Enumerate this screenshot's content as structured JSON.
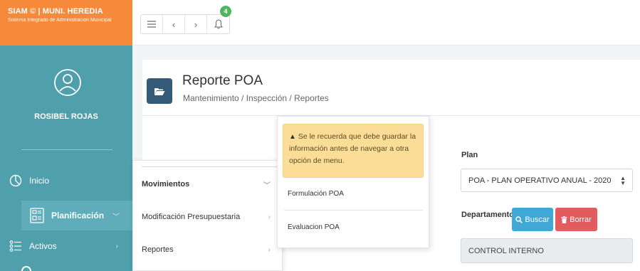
{
  "brand": {
    "title": "SIAM © | MUNI. HEREDIA",
    "subtitle": "Sistema Integrado de Administración Municipal"
  },
  "user": {
    "name": "ROSIBEL ROJAS"
  },
  "sidebar": {
    "items": [
      {
        "label": "Inicio",
        "icon": "pie-chart-icon"
      },
      {
        "label": "Planificación",
        "icon": "planning-icon"
      },
      {
        "label": "Activos",
        "icon": "list-icon"
      }
    ]
  },
  "topbar": {
    "notification_count": "4"
  },
  "page": {
    "title": "Reporte POA",
    "breadcrumb": "Mantenimiento / Inspección / Reportes"
  },
  "menu": {
    "items": [
      {
        "label": "Movimientos"
      },
      {
        "label": "Modificación Presupuestaria"
      },
      {
        "label": "Reportes"
      }
    ],
    "submenu": {
      "alert": "Se le recuerda que debe guardar la información antes de navegar a otra opción de menu.",
      "items": [
        {
          "label": "Formulación POA"
        },
        {
          "label": "Evaluacion POA"
        }
      ]
    }
  },
  "form": {
    "plan_label": "Plan",
    "plan_value": "POA - PLAN OPERATIVO ANUAL - 2020",
    "dept_label": "Departamento",
    "search_label": "Buscar",
    "clear_label": "Borrar",
    "dept_value": "CONTROL INTERNO"
  },
  "colors": {
    "brand": "#f7893b",
    "sidebar": "#4f9fad",
    "search": "#3fa8d5",
    "clear": "#e25b5f",
    "alert": "#fcdd97",
    "badge": "#52b462"
  }
}
